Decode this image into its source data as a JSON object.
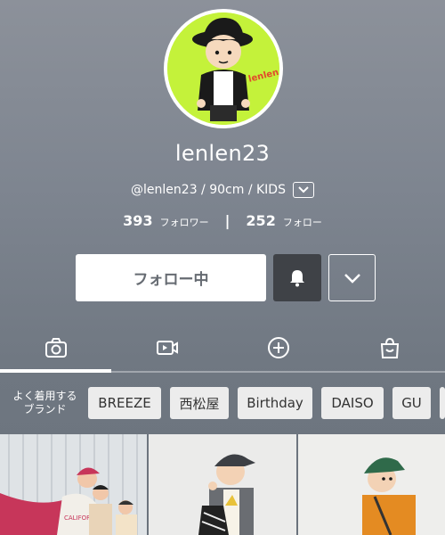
{
  "profile": {
    "username": "lenlen23",
    "bio": "@lenlen23 / 90cm / KIDS",
    "avatar_text": "lenlen",
    "followers_count": "393",
    "followers_label": "フォロワー",
    "following_count": "252",
    "following_label": "フォロー"
  },
  "actions": {
    "follow_label": "フォロー中",
    "bell_icon": "bell-icon",
    "more_icon": "chevron-down-icon"
  },
  "tabs": [
    {
      "icon": "camera-icon",
      "active": true
    },
    {
      "icon": "video-icon",
      "active": false
    },
    {
      "icon": "plus-circle-icon",
      "active": false
    },
    {
      "icon": "shopping-bag-icon",
      "active": false
    }
  ],
  "brands": {
    "label_line1": "よく着用する",
    "label_line2": "ブランド",
    "items": [
      "BREEZE",
      "西松屋",
      "Birthday",
      "DAISO",
      "GU"
    ]
  },
  "photos": [
    {
      "shirt_text": "CALIFORNIA"
    },
    {
      "shirt_text": ""
    },
    {
      "shirt_text": ""
    }
  ],
  "colors": {
    "avatar_bg": "#c4f23a",
    "bell_bg": "#3f4247",
    "chip_bg": "#ececec"
  }
}
